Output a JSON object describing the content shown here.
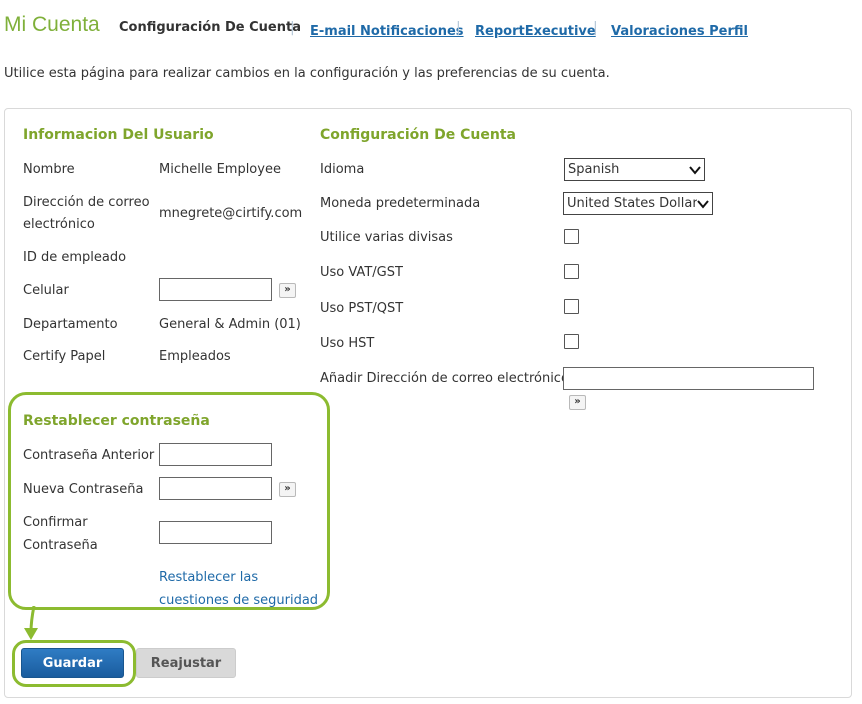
{
  "header": {
    "title": "Mi Cuenta",
    "tabs": [
      {
        "label": "Configuración De Cuenta"
      },
      {
        "label": "E-mail Notificaciones"
      },
      {
        "label": "ReportExecutive"
      },
      {
        "label": "Valoraciones Perfil"
      }
    ]
  },
  "intro": "Utilice esta página para realizar cambios en la configuración y las preferencias de su cuenta.",
  "user_info": {
    "title": "Informacion Del Usuario",
    "name_label": "Nombre",
    "name_value": "Michelle Employee",
    "email_label_1": "Dirección de correo",
    "email_label_2": "electrónico",
    "email_value": "mnegrete@cirtify.com",
    "employee_id_label": "ID de empleado",
    "cell_label": "Celular",
    "cell_value": "",
    "department_label": "Departamento",
    "department_value": "General & Admin (01)",
    "role_label": "Certify Papel",
    "role_value": "Empleados"
  },
  "password": {
    "title": "Restablecer contraseña",
    "old_label": "Contraseña Anterior",
    "new_label": "Nueva Contraseña",
    "confirm_label_1": "Confirmar",
    "confirm_label_2": "Contraseña",
    "security_link_1": "Restablecer las",
    "security_link_2": "cuestiones de seguridad"
  },
  "account_config": {
    "title": "Configuración De Cuenta",
    "language_label": "Idioma",
    "language_value": "Spanish",
    "currency_label": "Moneda predeterminada",
    "currency_value": "United States Dollars",
    "multi_currency_label": "Utilice varias divisas",
    "multi_currency_checked": false,
    "vat_label": "Uso VAT/GST",
    "vat_checked": false,
    "pst_label": "Uso PST/QST",
    "pst_checked": false,
    "hst_label": "Uso HST",
    "hst_checked": false,
    "add_email_label": "Añadir Dirección de correo electrónico",
    "add_email_value": ""
  },
  "buttons": {
    "save": "Guardar",
    "reset": "Reajustar",
    "expand": "»"
  },
  "colors": {
    "accent_green": "#7fa52c",
    "highlight_green": "#8cbb30",
    "link_blue": "#1f6aa8",
    "save_blue": "#1a5c9e"
  }
}
